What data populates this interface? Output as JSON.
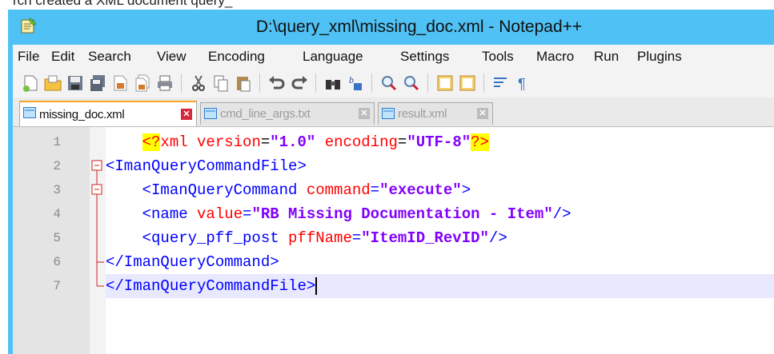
{
  "top_text": "rch created a XML document query_",
  "window": {
    "title": "D:\\query_xml\\missing_doc.xml - Notepad++"
  },
  "menu": [
    "File",
    "Edit",
    "Search",
    "View",
    "Encoding",
    "Language",
    "Settings",
    "Tools",
    "Macro",
    "Run",
    "Plugins"
  ],
  "toolbar_icons": [
    "new-file-icon",
    "open-file-icon",
    "save-icon",
    "save-all-icon",
    "close-icon",
    "close-all-icon",
    "print-icon",
    "cut-icon",
    "copy-icon",
    "paste-icon",
    "undo-icon",
    "redo-icon",
    "find-icon",
    "replace-icon",
    "zoom-in-icon",
    "zoom-out-icon",
    "sync-vertical-icon",
    "sync-horizontal-icon",
    "word-wrap-icon",
    "show-all-chars-icon"
  ],
  "tabs": [
    {
      "label": "missing_doc.xml",
      "active": true
    },
    {
      "label": "cmd_line_args.txt",
      "active": false
    },
    {
      "label": "result.xml",
      "active": false
    }
  ],
  "editor": {
    "line_numbers": [
      "1",
      "2",
      "3",
      "4",
      "5",
      "6",
      "7"
    ],
    "lines": [
      {
        "indent": "    ",
        "pre": "<?",
        "xml": "xml ",
        "a1": "version",
        "eq1": "=",
        "v1": "\"1.0\"",
        "sp": " ",
        "a2": "encoding",
        "eq2": "=",
        "v2": "\"UTF-8\"",
        "post": "?>"
      },
      {
        "text": "<ImanQueryCommandFile>"
      },
      {
        "indent": "    ",
        "tag": "<ImanQueryCommand ",
        "attr": "command",
        "eq": "=",
        "val": "\"execute\"",
        "end": ">"
      },
      {
        "indent": "    ",
        "tag": "<name ",
        "attr": "value",
        "eq": "=",
        "val": "\"RB Missing Documentation - Item\"",
        "end": "/>"
      },
      {
        "indent": "    ",
        "tag": "<query_pff_post ",
        "attr": "pffName",
        "eq": "=",
        "val": "\"ItemID_RevID\"",
        "end": "/>"
      },
      {
        "text": "</ImanQueryCommand>"
      },
      {
        "text": "</ImanQueryCommandFile>"
      }
    ]
  },
  "colors": {
    "titlebar": "#4fc1f4",
    "tag": "#0000ff",
    "attribute": "#ff0000",
    "value": "#8000ff",
    "current_line": "#e8e8ff"
  }
}
